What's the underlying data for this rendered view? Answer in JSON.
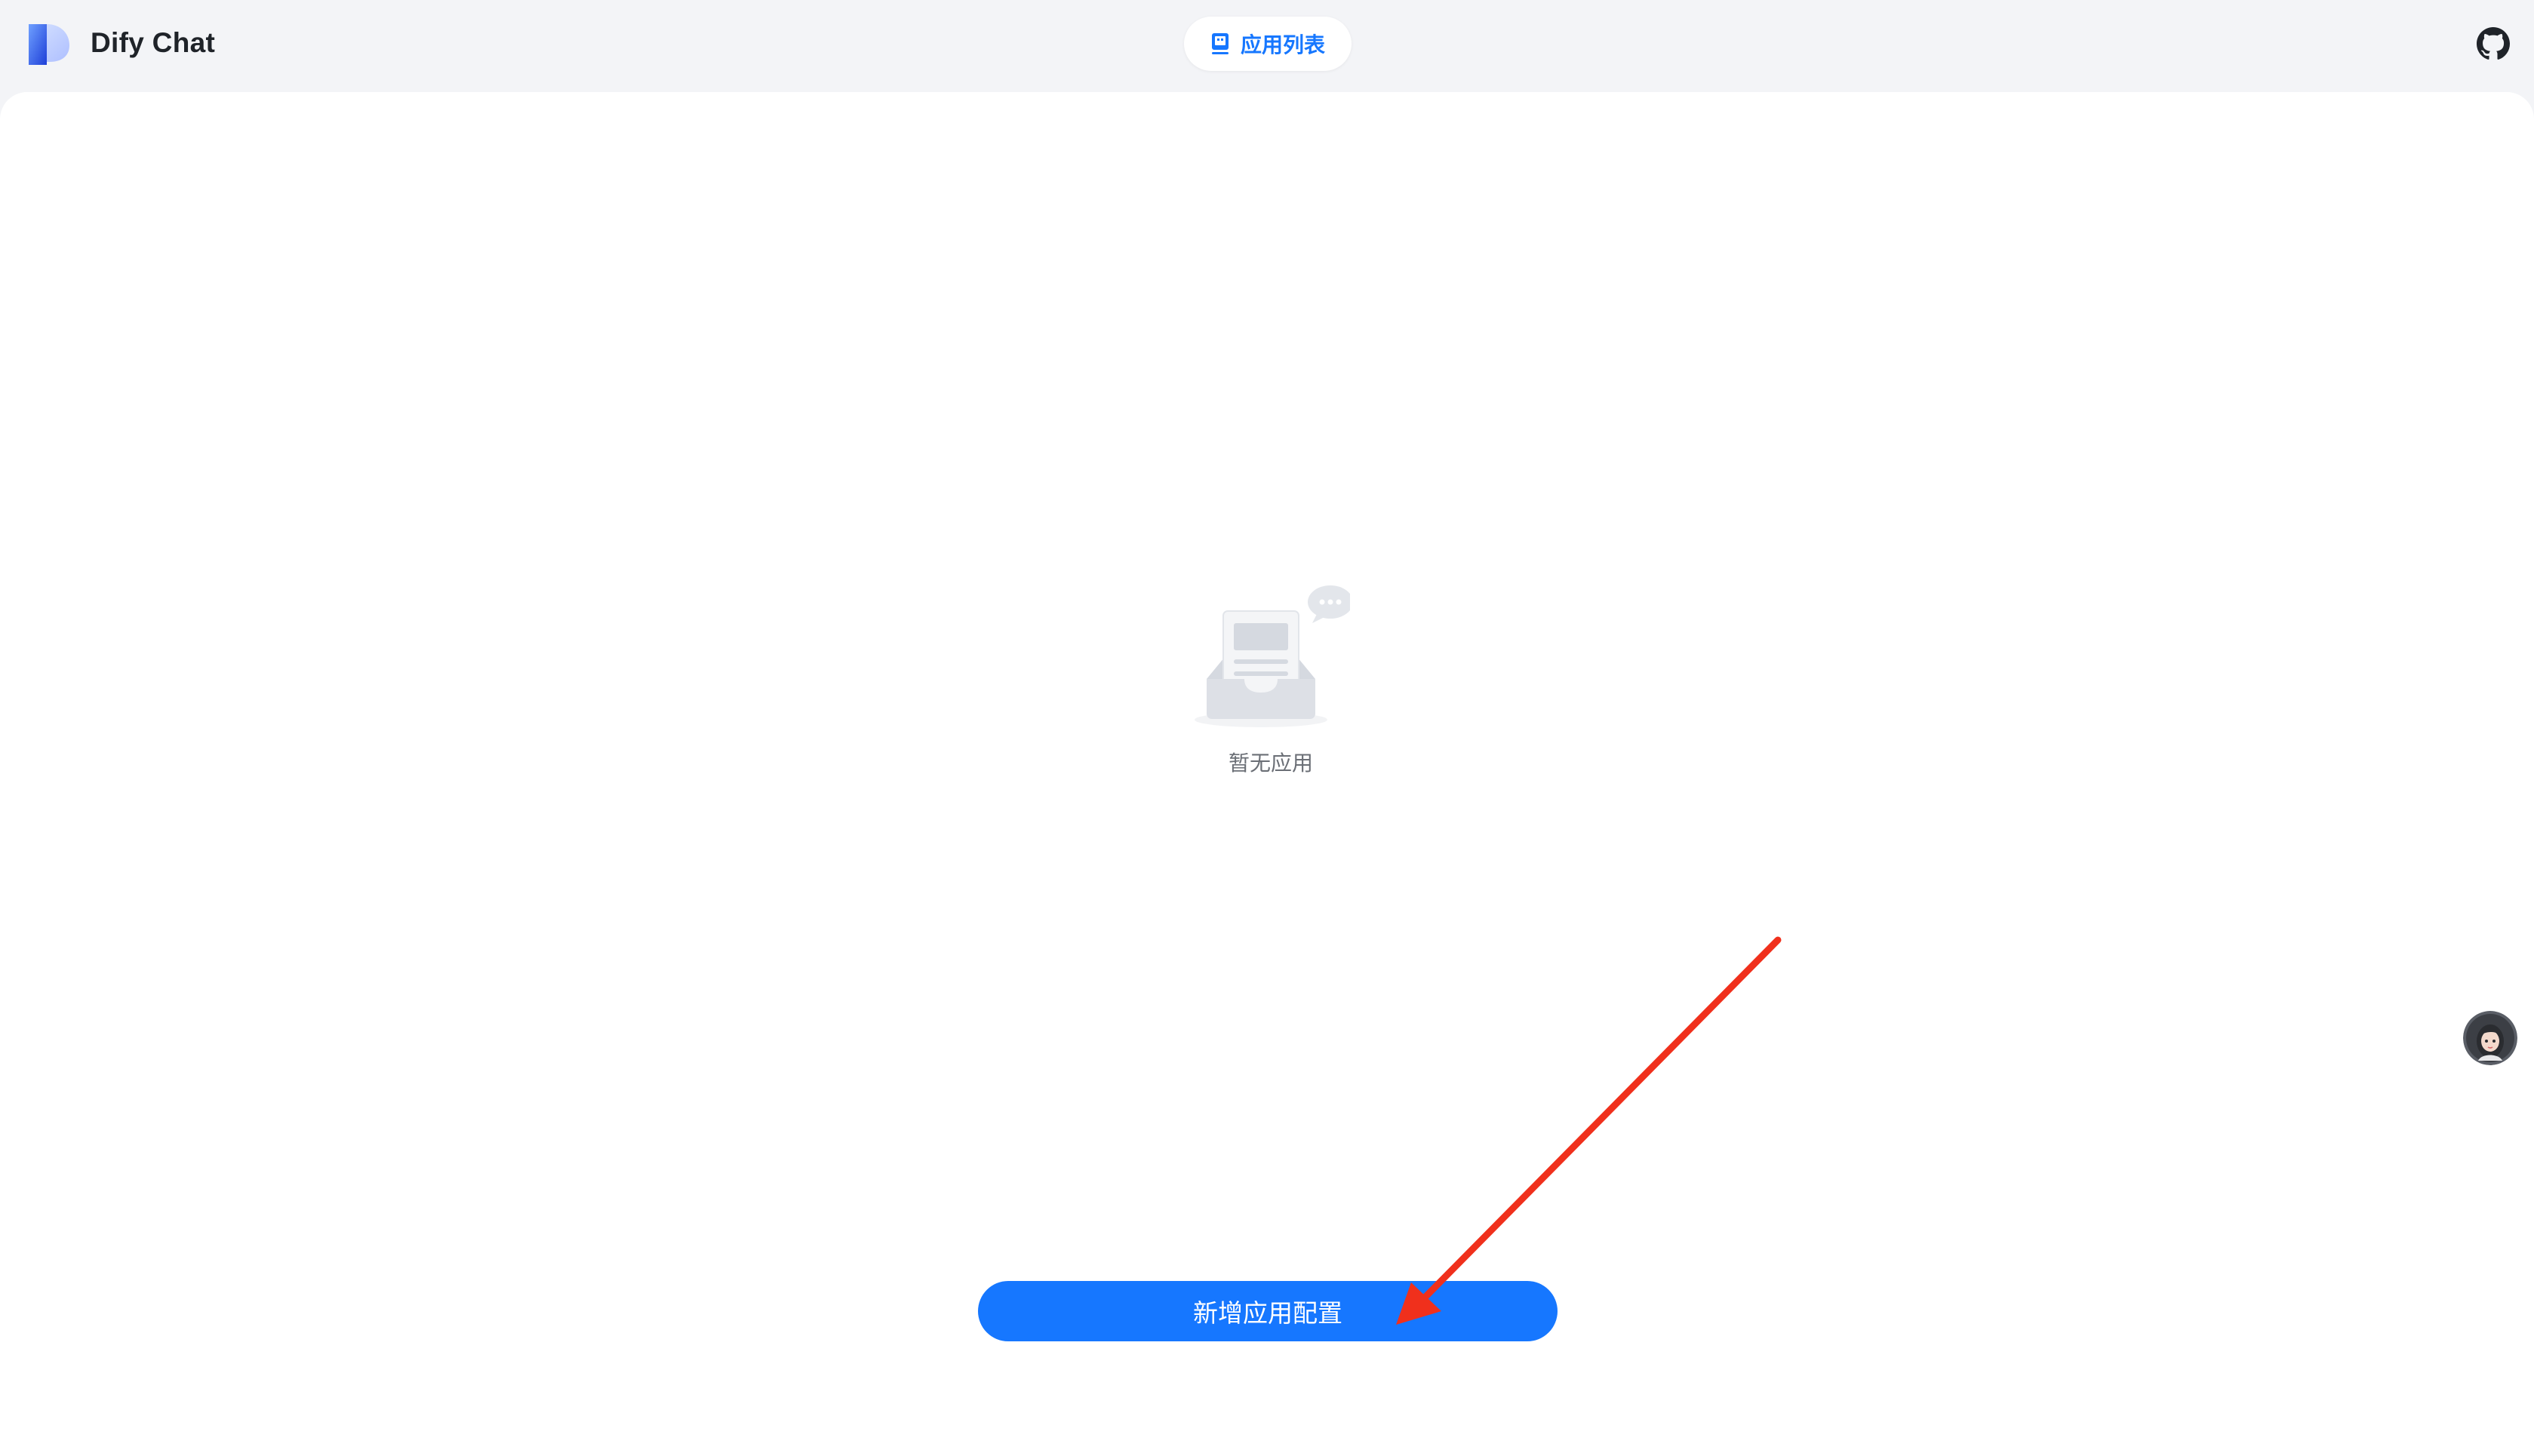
{
  "header": {
    "brand_title": "Dify Chat",
    "nav_pill_label": "应用列表",
    "github_icon": "github-icon"
  },
  "main": {
    "empty_text": "暂无应用",
    "add_button_label": "新增应用配置"
  },
  "colors": {
    "accent": "#1677ff",
    "background": "#f3f4f7",
    "card": "#ffffff",
    "annotation_arrow": "#f0301c"
  }
}
